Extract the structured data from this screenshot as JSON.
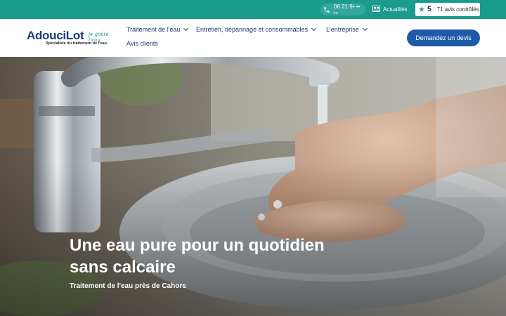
{
  "topbar": {
    "phone": "06 21 9• •• ••",
    "news_label": "Actualités",
    "reviews": {
      "score": "5",
      "separator": "|",
      "count_label": "71 avis contrôlés"
    }
  },
  "header": {
    "logo": {
      "main": "AdouciLot",
      "script": "je goûte l'eau",
      "tagline": "Spécialiste du traitement de l'eau"
    },
    "nav": [
      {
        "label": "Traitement de l'eau",
        "has_dropdown": true
      },
      {
        "label": "Entretien, dépannage et consommables",
        "has_dropdown": true
      },
      {
        "label": "L'entreprise",
        "has_dropdown": true
      },
      {
        "label": "Avis clients",
        "has_dropdown": false
      }
    ],
    "cta_label": "Demandez un devis"
  },
  "hero": {
    "title_line1": "Une eau pure pour un quotidien",
    "title_line2": "sans calcaire",
    "subtitle": "Traitement de l'eau près de Cahors"
  },
  "colors": {
    "topbar": "#1a9b8c",
    "brand_navy": "#1e3a78",
    "cta": "#1f5aa8"
  }
}
